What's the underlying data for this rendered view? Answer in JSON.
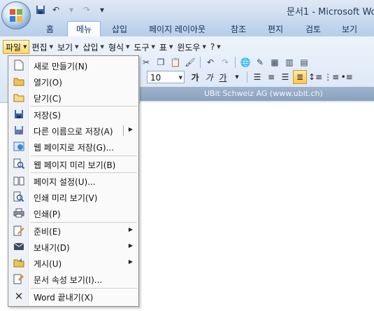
{
  "window": {
    "title": "문서1 - Microsoft Wo"
  },
  "quick_access": [
    {
      "icon": "save-icon",
      "glyph": "💾"
    },
    {
      "icon": "undo-icon",
      "glyph": "↶"
    },
    {
      "icon": "dropdown-icon",
      "glyph": "▾"
    },
    {
      "icon": "redo-icon",
      "glyph": "↷"
    },
    {
      "icon": "customize-icon",
      "glyph": "▾"
    }
  ],
  "ribbon": {
    "tabs": [
      "홈",
      "메뉴",
      "삽입",
      "페이지 레이아웃",
      "참조",
      "편지",
      "검토",
      "보기"
    ],
    "active_tab": "메뉴"
  },
  "menubar": {
    "items": [
      "파일",
      "편집",
      "보기",
      "삽입",
      "형식",
      "도구",
      "표",
      "윈도우",
      "?"
    ],
    "open_item": "파일"
  },
  "toolbar": {
    "font_size": "10",
    "format_buttons": [
      "가",
      "가",
      "가"
    ],
    "bar_text": "UBit Schweiz AG    (www.ubit.ch)"
  },
  "file_menu": {
    "items": [
      {
        "label": "새로 만들기(N)",
        "icon": "new-document-icon",
        "submenu": false
      },
      {
        "label": "열기(O)",
        "icon": "open-folder-icon",
        "submenu": false
      },
      {
        "label": "닫기(C)",
        "icon": "close-folder-icon",
        "submenu": false
      },
      {
        "label": "저장(S)",
        "icon": "save-icon",
        "submenu": false,
        "separator_before": true
      },
      {
        "label": "다른 이름으로 저장(A)",
        "icon": "save-as-icon",
        "submenu": true
      },
      {
        "label": "웹 페이지로 저장(G)...",
        "icon": "save-web-icon",
        "submenu": false
      },
      {
        "label": "웹 페이지 미리 보기(B)",
        "icon": "web-preview-icon",
        "submenu": false,
        "separator_before": true
      },
      {
        "label": "페이지 설정(U)...",
        "icon": "page-setup-icon",
        "submenu": false,
        "separator_before": true
      },
      {
        "label": "인쇄 미리 보기(V)",
        "icon": "print-preview-icon",
        "submenu": false
      },
      {
        "label": "인쇄(P)",
        "icon": "print-icon",
        "submenu": false
      },
      {
        "label": "준비(E)",
        "icon": "prepare-icon",
        "submenu": true,
        "separator_before": true
      },
      {
        "label": "보내기(D)",
        "icon": "send-icon",
        "submenu": true
      },
      {
        "label": "게시(U)",
        "icon": "publish-icon",
        "submenu": true
      },
      {
        "label": "문서 속성 보기(I)...",
        "icon": "properties-icon",
        "submenu": false
      },
      {
        "label": "Word 끝내기(X)",
        "icon": "exit-icon",
        "submenu": false,
        "separator_before": true
      }
    ]
  },
  "colors": {
    "accent": "#1e395b",
    "highlight": "#ffd866"
  }
}
